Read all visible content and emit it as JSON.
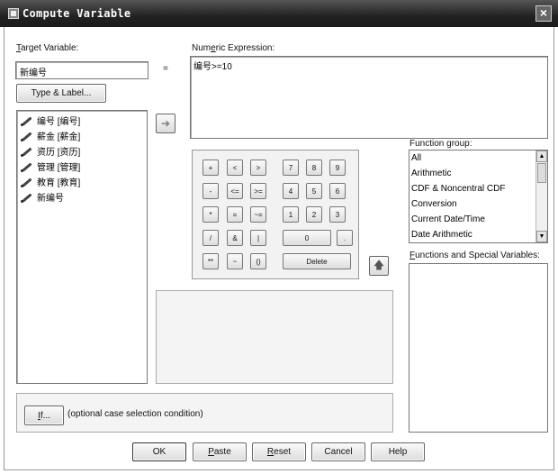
{
  "window": {
    "title": "Compute Variable",
    "close_glyph": "×"
  },
  "target": {
    "label_u": "T",
    "label_rest": "arget Variable:",
    "value": "新编号",
    "type_label_button": "Type & Label..."
  },
  "equals_sign": "=",
  "expression": {
    "label_pre": "Num",
    "label_u": "e",
    "label_rest": "ric Expression:",
    "value": "编号>=10"
  },
  "variables": [
    {
      "label": "编号 [编号]"
    },
    {
      "label": "薪金 [薪金]"
    },
    {
      "label": "资历 [资历]"
    },
    {
      "label": "管理 [管理]"
    },
    {
      "label": "教育 [教育]"
    },
    {
      "label": "新编号"
    }
  ],
  "keypad": {
    "rows": [
      [
        "+",
        "<",
        ">",
        "7",
        "8",
        "9"
      ],
      [
        "-",
        "<=",
        ">=",
        "4",
        "5",
        "6"
      ],
      [
        "*",
        "=",
        "~=",
        "1",
        "2",
        "3"
      ],
      [
        "/",
        "&",
        "|",
        "0",
        "."
      ],
      [
        "**",
        "~",
        "()",
        "Delete"
      ]
    ]
  },
  "function_group": {
    "label_pre": "Function ",
    "label_u": "g",
    "label_rest": "roup:",
    "items": [
      "All",
      "Arithmetic",
      "CDF & Noncentral CDF",
      "Conversion",
      "Current Date/Time",
      "Date Arithmetic"
    ]
  },
  "functions_special": {
    "label_u": "F",
    "label_rest": "unctions and Special Variables:"
  },
  "if_button": {
    "label_u": "I",
    "label_rest": "f..."
  },
  "if_condition_text": "(optional case selection condition)",
  "buttons": {
    "ok": "OK",
    "paste_u": "P",
    "paste_rest": "aste",
    "reset_u": "R",
    "reset_rest": "eset",
    "cancel": "Cancel",
    "help": "Help"
  },
  "icons": {
    "move_right": "arrow-right-icon",
    "move_up": "arrow-up-icon",
    "variable": "pencil-icon"
  }
}
